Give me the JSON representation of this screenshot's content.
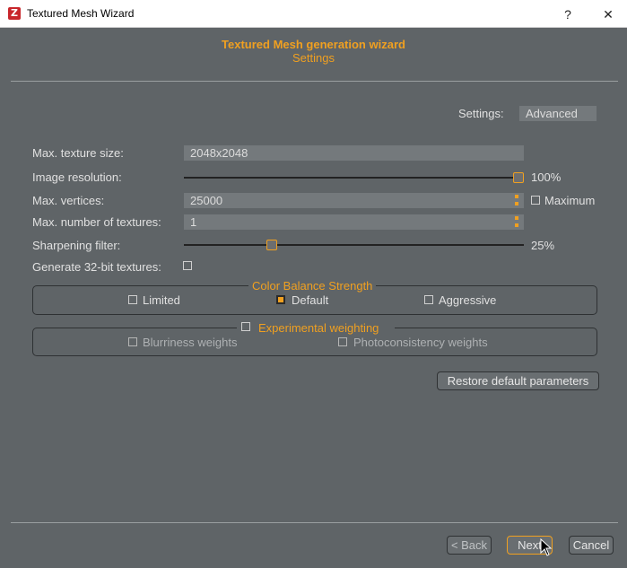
{
  "window": {
    "title": "Textured Mesh Wizard",
    "help_label": "?",
    "close_label": "✕",
    "app_icon_letter": "Z"
  },
  "header": {
    "title": "Textured Mesh generation wizard",
    "subtitle": "Settings"
  },
  "settings": {
    "label": "Settings:",
    "value": "Advanced"
  },
  "form": {
    "max_texture_size": {
      "label": "Max. texture size:",
      "value": "2048x2048"
    },
    "image_resolution": {
      "label": "Image resolution:",
      "value": "100%",
      "fraction": 1.0
    },
    "max_vertices": {
      "label": "Max. vertices:",
      "value": "25000",
      "maximum_label": "Maximum",
      "maximum_checked": false
    },
    "max_textures": {
      "label": "Max. number of textures:",
      "value": "1"
    },
    "sharpening": {
      "label": "Sharpening filter:",
      "value": "25%",
      "fraction": 0.25
    },
    "gen32bit": {
      "label": "Generate 32-bit textures:",
      "checked": false
    }
  },
  "color_balance": {
    "title": "Color Balance Strength",
    "options": [
      {
        "label": "Limited",
        "checked": false
      },
      {
        "label": "Default",
        "checked": true
      },
      {
        "label": "Aggressive",
        "checked": false
      }
    ]
  },
  "experimental": {
    "title": "Experimental weighting",
    "checked": false,
    "options": [
      {
        "label": "Blurriness weights",
        "checked": false
      },
      {
        "label": "Photoconsistency weights",
        "checked": false
      }
    ]
  },
  "buttons": {
    "restore": "Restore default parameters",
    "back": "< Back",
    "next": "Next",
    "cancel": "Cancel"
  },
  "colors": {
    "accent": "#f0a020",
    "background": "#5f6467",
    "field": "#74797c"
  }
}
